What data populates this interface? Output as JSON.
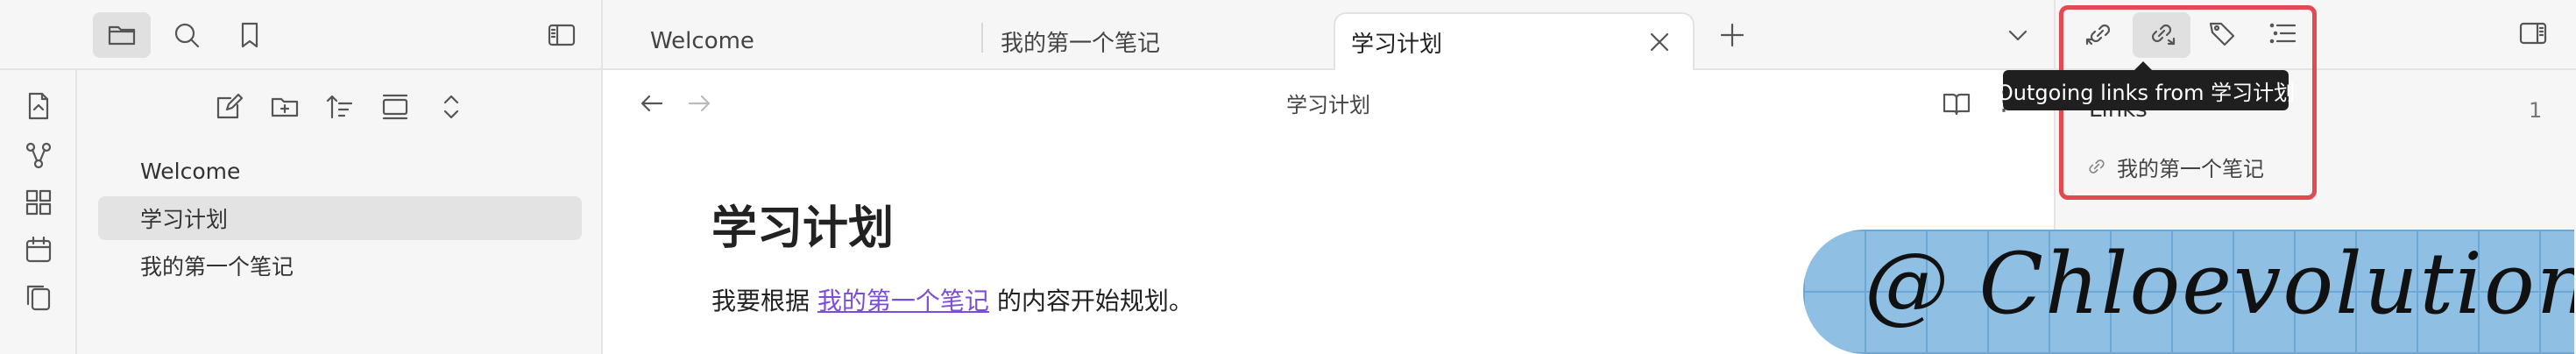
{
  "sidebar_top": {
    "icons": [
      "folder-icon",
      "search-icon",
      "bookmark-icon"
    ],
    "collapse_icon": "sidebar-left-icon"
  },
  "ribbon": {
    "icons": [
      "open-file-icon",
      "graph-icon",
      "dashboard-icon",
      "calendar-icon",
      "copy-icon"
    ]
  },
  "explorer": {
    "toolbar_icons": [
      "new-note-icon",
      "new-folder-icon",
      "sort-icon",
      "collapse-all-icon",
      "expand-icon"
    ],
    "files": [
      {
        "label": "Welcome",
        "selected": false
      },
      {
        "label": "学习计划",
        "selected": true
      },
      {
        "label": "我的第一个笔记",
        "selected": false
      }
    ]
  },
  "tabs": [
    {
      "label": "Welcome",
      "active": false
    },
    {
      "label": "我的第一个笔记",
      "active": false
    },
    {
      "label": "学习计划",
      "active": true
    }
  ],
  "editor": {
    "header_title": "学习计划",
    "note_title": "学习计划",
    "body_before": "我要根据 ",
    "body_link": "我的第一个笔记",
    "body_after": " 的内容开始规划。",
    "link_color": "#7c4ddb"
  },
  "right_panel": {
    "tooltip": "Outgoing links from 学习计划",
    "section_title": "Links",
    "count": "1",
    "link_item": "我的第一个笔记"
  },
  "watermark": {
    "text": "@ Chloevolution"
  },
  "colors": {
    "highlight_border": "#e34a50",
    "panel_bg": "#f6f6f6"
  }
}
